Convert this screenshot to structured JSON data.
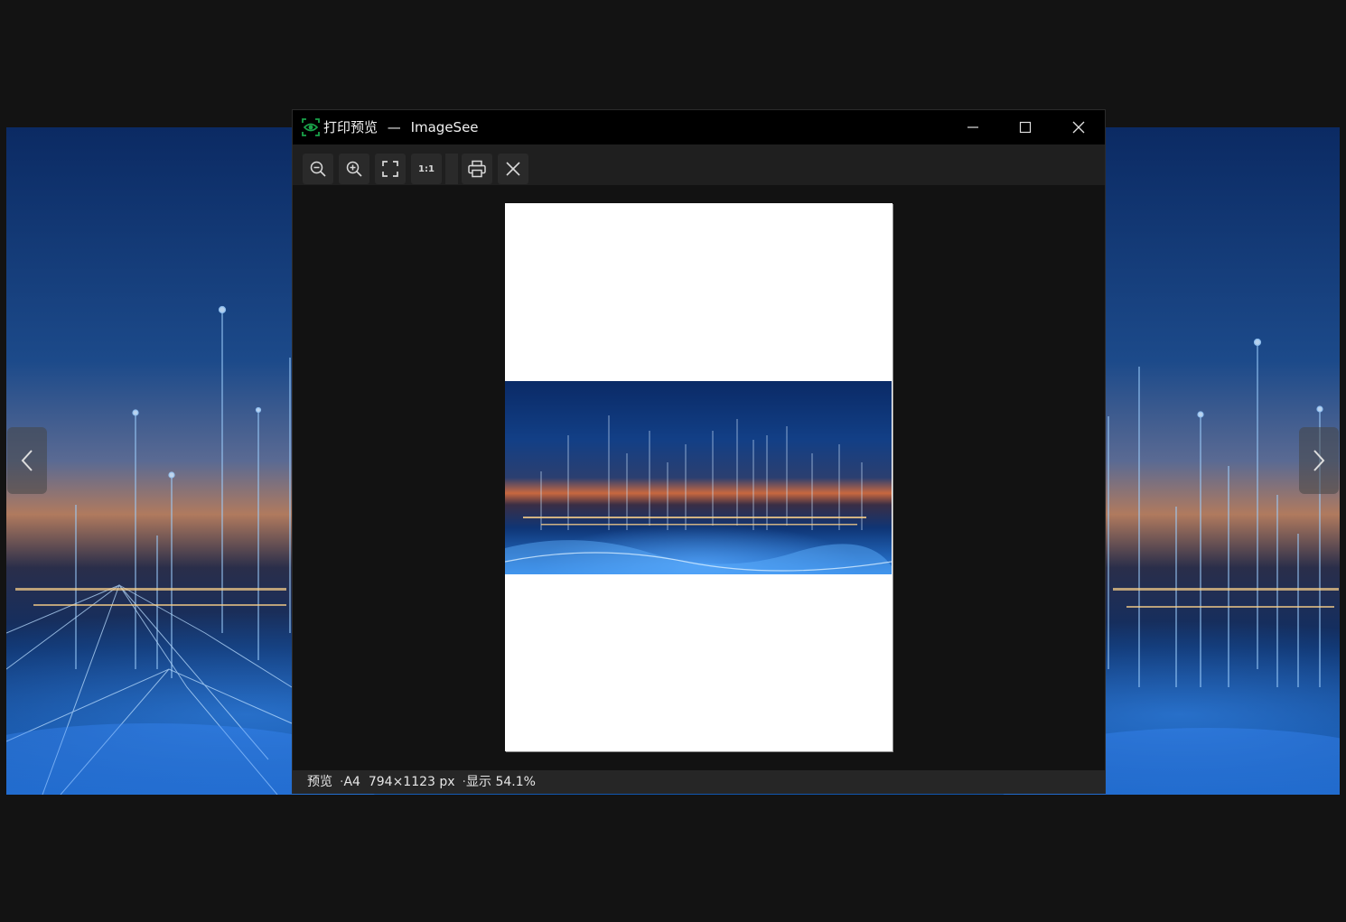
{
  "window": {
    "title_app": "打印预览",
    "title_sep": "—",
    "title_name": "ImageSee",
    "controls": [
      "minimize-icon",
      "maximize-icon",
      "close-icon"
    ]
  },
  "toolbar": {
    "tools": [
      {
        "name": "zoom-out",
        "icon": "zoom-out-icon"
      },
      {
        "name": "zoom-in",
        "icon": "zoom-in-icon"
      },
      {
        "name": "fit",
        "icon": "fullscreen-icon"
      },
      {
        "name": "actual-size",
        "label": "1:1"
      },
      {
        "name": "print",
        "icon": "printer-icon"
      },
      {
        "name": "close-preview",
        "icon": "close-icon"
      }
    ]
  },
  "status": {
    "mode": "预览",
    "paper": "A4",
    "size": "794×1123 px",
    "zoom": "显示 54.1%"
  },
  "colors": {
    "titlebar": "#000000",
    "toolbar": "#1f1f1f",
    "statusbar": "#262626",
    "accent": "#1aa34a"
  }
}
